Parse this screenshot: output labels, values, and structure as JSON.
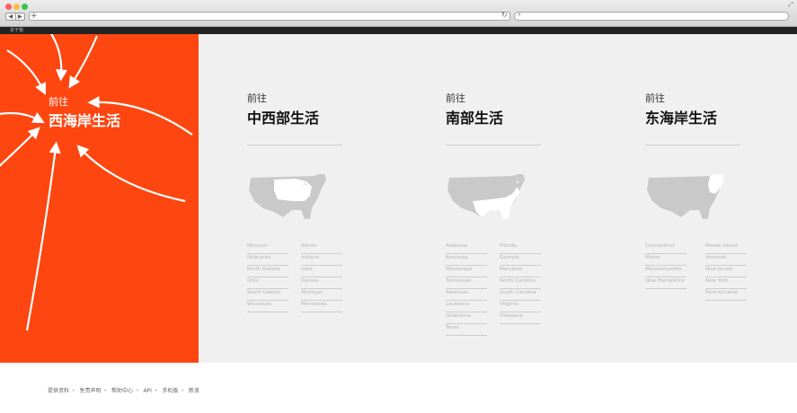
{
  "bookmark_bar": {
    "item": "关于我"
  },
  "hero": {
    "small": "前往",
    "title": "西海岸生活"
  },
  "columns": [
    {
      "small": "前往",
      "title": "中西部生活",
      "states_left": [
        "Missouri",
        "Nebraska",
        "North Dakota",
        "Ohio",
        "South Dakota",
        "Wisconsin"
      ],
      "states_right": [
        "Illinois",
        "Indiana",
        "Iowa",
        "Kansas",
        "Michigan",
        "Minnesota"
      ]
    },
    {
      "small": "前往",
      "title": "南部生活",
      "states_left": [
        "Alabama",
        "Kentucky",
        "Mississippi",
        "Tennessee",
        "Arkansas",
        "Louisiana",
        "Oklahoma",
        "Texas"
      ],
      "states_right": [
        "Florida",
        "Georgia",
        "Maryland",
        "North Carolina",
        "South Carolina",
        "Virginia",
        "Delaware"
      ]
    },
    {
      "small": "前往",
      "title": "东海岸生活",
      "states_left": [
        "Connecticut",
        "Maine",
        "Massachusetts",
        "New Hampshire"
      ],
      "states_right": [
        "Rhode Island",
        "Vermont",
        "New Jersey",
        "New York",
        "Pennsylvania"
      ]
    }
  ],
  "footer": [
    "提供资料",
    "免责声明",
    "帮助中心",
    "API",
    "手机版",
    "新浪"
  ],
  "colors": {
    "accent": "#fe4610",
    "background": "#f0f0f0",
    "map_gray": "#c9c9c9"
  }
}
